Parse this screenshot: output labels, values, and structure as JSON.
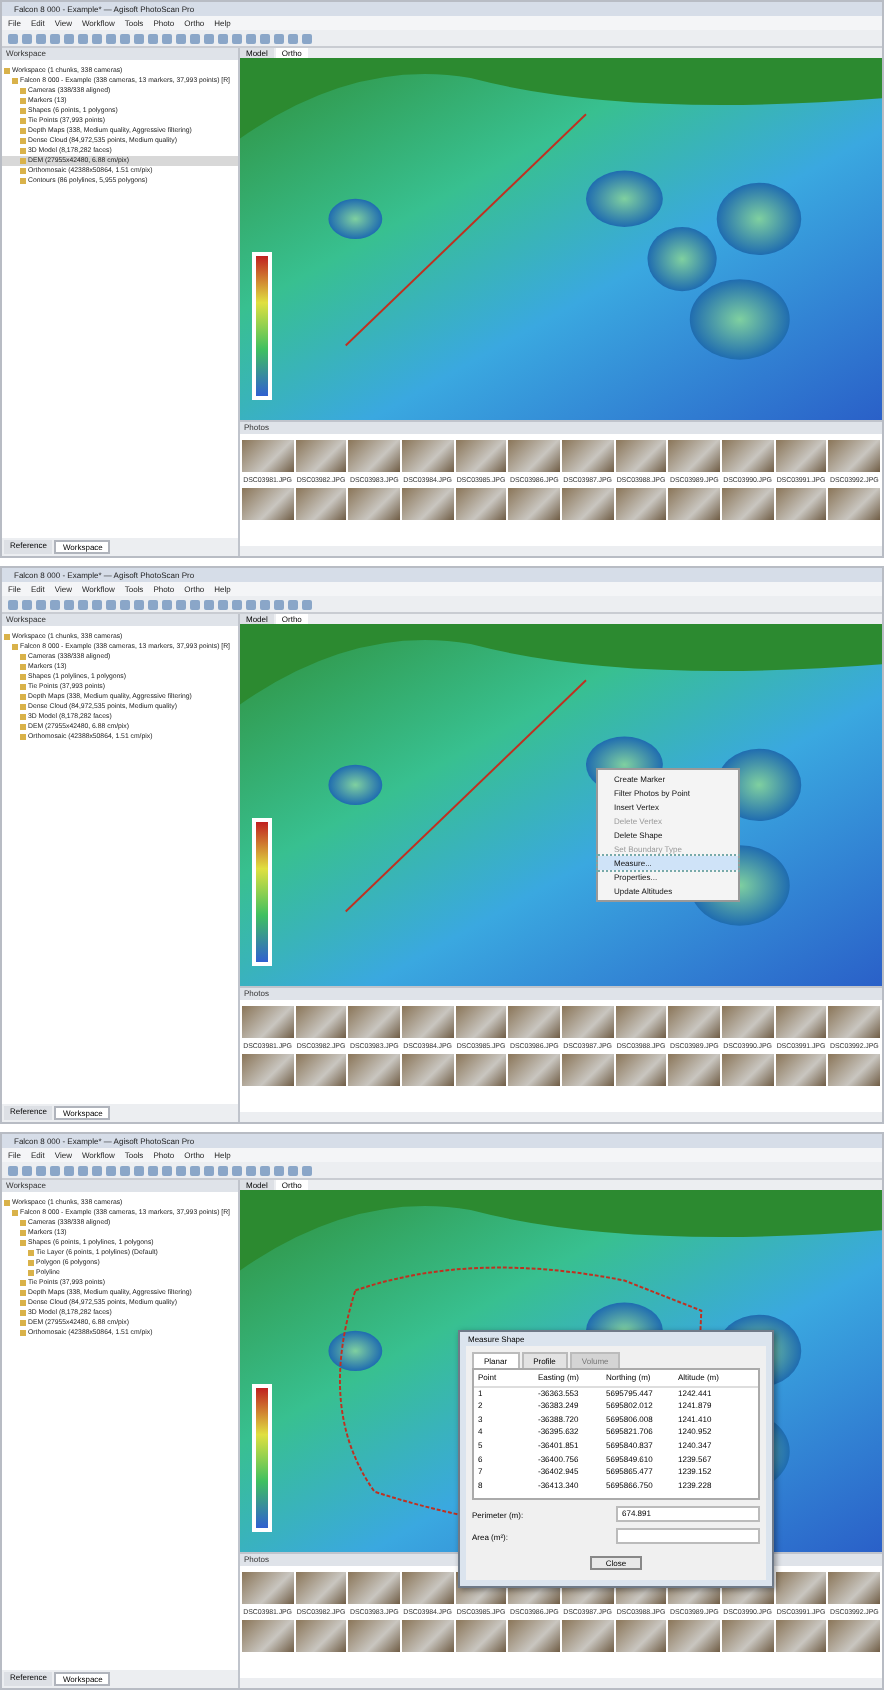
{
  "panels": [
    {
      "window_title": "Falcon 8 000 - Example* — Agisoft PhotoScan Pro",
      "menu": [
        "File",
        "Edit",
        "View",
        "Workflow",
        "Tools",
        "Photo",
        "Ortho",
        "Help"
      ],
      "workspace_title": "Workspace",
      "tree": [
        {
          "label": "Workspace (1 chunks, 338 cameras)",
          "selected": false,
          "children": [
            {
              "label": "Falcon 8 000 - Example (338 cameras, 13 markers, 37,993 points) [R]",
              "selected": false,
              "children": [
                {
                  "label": "Cameras (338/338 aligned)",
                  "selected": false
                },
                {
                  "label": "Markers (13)",
                  "selected": false
                },
                {
                  "label": "Shapes (6 points, 1 polygons)",
                  "selected": false
                },
                {
                  "label": "Tie Points (37,993 points)",
                  "selected": false
                },
                {
                  "label": "Depth Maps (338, Medium quality, Aggressive filtering)",
                  "selected": false
                },
                {
                  "label": "Dense Cloud (84,972,535 points, Medium quality)",
                  "selected": false
                },
                {
                  "label": "3D Model (8,178,282 faces)",
                  "selected": false
                },
                {
                  "label": "DEM (27955x42480, 6.88 cm/pix)",
                  "selected": true
                },
                {
                  "label": "Orthomosaic (42388x50864, 1.51 cm/pix)",
                  "selected": false
                },
                {
                  "label": "Contours (86 polylines, 5,955 polygons)",
                  "selected": false
                }
              ]
            }
          ]
        }
      ],
      "bottom_tabs": [
        {
          "label": "Reference",
          "selected": false
        },
        {
          "label": "Workspace",
          "selected": true
        }
      ],
      "view_tabs": [
        {
          "label": "Model",
          "selected": false
        },
        {
          "label": "Ortho",
          "selected": true
        }
      ],
      "shape": {
        "kind": "line"
      },
      "photos_title": "Photos",
      "photos": [
        "DSC03981.JPG",
        "DSC03982.JPG",
        "DSC03983.JPG",
        "DSC03984.JPG",
        "DSC03985.JPG",
        "DSC03986.JPG",
        "DSC03987.JPG",
        "DSC03988.JPG",
        "DSC03989.JPG",
        "DSC03990.JPG",
        "DSC03991.JPG",
        "DSC03992.JPG"
      ]
    },
    {
      "window_title": "Falcon 8 000 - Example* — Agisoft PhotoScan Pro",
      "menu": [
        "File",
        "Edit",
        "View",
        "Workflow",
        "Tools",
        "Photo",
        "Ortho",
        "Help"
      ],
      "workspace_title": "Workspace",
      "tree": [
        {
          "label": "Workspace (1 chunks, 338 cameras)",
          "selected": false,
          "children": [
            {
              "label": "Falcon 8 000 - Example (338 cameras, 13 markers, 37,993 points) [R]",
              "selected": false,
              "children": [
                {
                  "label": "Cameras (338/338 aligned)",
                  "selected": false
                },
                {
                  "label": "Markers (13)",
                  "selected": false
                },
                {
                  "label": "Shapes (1 polylines, 1 polygons)",
                  "selected": false
                },
                {
                  "label": "Tie Points (37,993 points)",
                  "selected": false
                },
                {
                  "label": "Depth Maps (338, Medium quality, Aggressive filtering)",
                  "selected": false
                },
                {
                  "label": "Dense Cloud (84,972,535 points, Medium quality)",
                  "selected": false
                },
                {
                  "label": "3D Model (8,178,282 faces)",
                  "selected": false
                },
                {
                  "label": "DEM (27955x42480, 6.88 cm/pix)",
                  "selected": false
                },
                {
                  "label": "Orthomosaic (42388x50864, 1.51 cm/pix)",
                  "selected": false
                }
              ]
            }
          ]
        }
      ],
      "bottom_tabs": [
        {
          "label": "Reference",
          "selected": false
        },
        {
          "label": "Workspace",
          "selected": true
        }
      ],
      "view_tabs": [
        {
          "label": "Model",
          "selected": false
        },
        {
          "label": "Ortho",
          "selected": true
        }
      ],
      "shape": {
        "kind": "line"
      },
      "photos_title": "Photos",
      "photos": [
        "DSC03981.JPG",
        "DSC03982.JPG",
        "DSC03983.JPG",
        "DSC03984.JPG",
        "DSC03985.JPG",
        "DSC03986.JPG",
        "DSC03987.JPG",
        "DSC03988.JPG",
        "DSC03989.JPG",
        "DSC03990.JPG",
        "DSC03991.JPG",
        "DSC03992.JPG"
      ],
      "context_menu": [
        {
          "label": "Create Marker",
          "disabled": false,
          "selected": false
        },
        {
          "label": "Filter Photos by Point",
          "disabled": false,
          "selected": false
        },
        {
          "label": "Insert Vertex",
          "disabled": false,
          "selected": false
        },
        {
          "label": "Delete Vertex",
          "disabled": true,
          "selected": false
        },
        {
          "label": "Delete Shape",
          "disabled": false,
          "selected": false
        },
        {
          "label": "Set Boundary Type",
          "disabled": true,
          "selected": false
        },
        {
          "label": "Measure...",
          "disabled": false,
          "selected": true
        },
        {
          "label": "Properties...",
          "disabled": false,
          "selected": false
        },
        {
          "label": "Update Altitudes",
          "disabled": false,
          "selected": false
        }
      ]
    },
    {
      "window_title": "Falcon 8 000 - Example* — Agisoft PhotoScan Pro",
      "menu": [
        "File",
        "Edit",
        "View",
        "Workflow",
        "Tools",
        "Photo",
        "Ortho",
        "Help"
      ],
      "workspace_title": "Workspace",
      "tree": [
        {
          "label": "Workspace (1 chunks, 338 cameras)",
          "selected": false,
          "children": [
            {
              "label": "Falcon 8 000 - Example (338 cameras, 13 markers, 37,993 points) [R]",
              "selected": false,
              "children": [
                {
                  "label": "Cameras (338/338 aligned)",
                  "selected": false
                },
                {
                  "label": "Markers (13)",
                  "selected": false
                },
                {
                  "label": "Shapes (6 points, 1 polylines, 1 polygons)",
                  "selected": false,
                  "children": [
                    {
                      "label": "Tie Layer (6 points, 1 polylines) (Default)",
                      "selected": false
                    },
                    {
                      "label": "Polygon (6 polygons)",
                      "selected": false
                    },
                    {
                      "label": "Polyline",
                      "selected": false
                    }
                  ]
                },
                {
                  "label": "Tie Points (37,993 points)",
                  "selected": false
                },
                {
                  "label": "Depth Maps (338, Medium quality, Aggressive filtering)",
                  "selected": false
                },
                {
                  "label": "Dense Cloud (84,972,535 points, Medium quality)",
                  "selected": false
                },
                {
                  "label": "3D Model (8,178,282 faces)",
                  "selected": false
                },
                {
                  "label": "DEM (27955x42480, 6.88 cm/pix)",
                  "selected": false
                },
                {
                  "label": "Orthomosaic (42388x50864, 1.51 cm/pix)",
                  "selected": false
                }
              ]
            }
          ]
        }
      ],
      "bottom_tabs": [
        {
          "label": "Reference",
          "selected": false
        },
        {
          "label": "Workspace",
          "selected": true
        }
      ],
      "view_tabs": [
        {
          "label": "Model",
          "selected": false
        },
        {
          "label": "Ortho",
          "selected": true
        }
      ],
      "shape": {
        "kind": "polygon"
      },
      "photos_title": "Photos",
      "photos": [
        "DSC03981.JPG",
        "DSC03982.JPG",
        "DSC03983.JPG",
        "DSC03984.JPG",
        "DSC03985.JPG",
        "DSC03986.JPG",
        "DSC03987.JPG",
        "DSC03988.JPG",
        "DSC03989.JPG",
        "DSC03990.JPG",
        "DSC03991.JPG",
        "DSC03992.JPG"
      ],
      "dialog": {
        "title": "Measure Shape",
        "tabs": [
          {
            "label": "Planar",
            "selected": true,
            "disabled": false
          },
          {
            "label": "Profile",
            "selected": false,
            "disabled": false
          },
          {
            "label": "Volume",
            "selected": false,
            "disabled": true
          }
        ],
        "columns": [
          "Point",
          "Easting (m)",
          "Northing (m)",
          "Altitude (m)"
        ],
        "rows": [
          [
            "1",
            "-36363.553",
            "5695795.447",
            "1242.441"
          ],
          [
            "2",
            "-36383.249",
            "5695802.012",
            "1241.879"
          ],
          [
            "3",
            "-36388.720",
            "5695806.008",
            "1241.410"
          ],
          [
            "4",
            "-36395.632",
            "5695821.706",
            "1240.952"
          ],
          [
            "5",
            "-36401.851",
            "5695840.837",
            "1240.347"
          ],
          [
            "6",
            "-36400.756",
            "5695849.610",
            "1239.567"
          ],
          [
            "7",
            "-36402.945",
            "5695865.477",
            "1239.152"
          ],
          [
            "8",
            "-36413.340",
            "5695866.750",
            "1239.228"
          ]
        ],
        "fields": [
          {
            "label": "Perimeter (m):",
            "value": "674.891"
          },
          {
            "label": "Area (m²):"
          }
        ],
        "button": "Close"
      }
    }
  ]
}
